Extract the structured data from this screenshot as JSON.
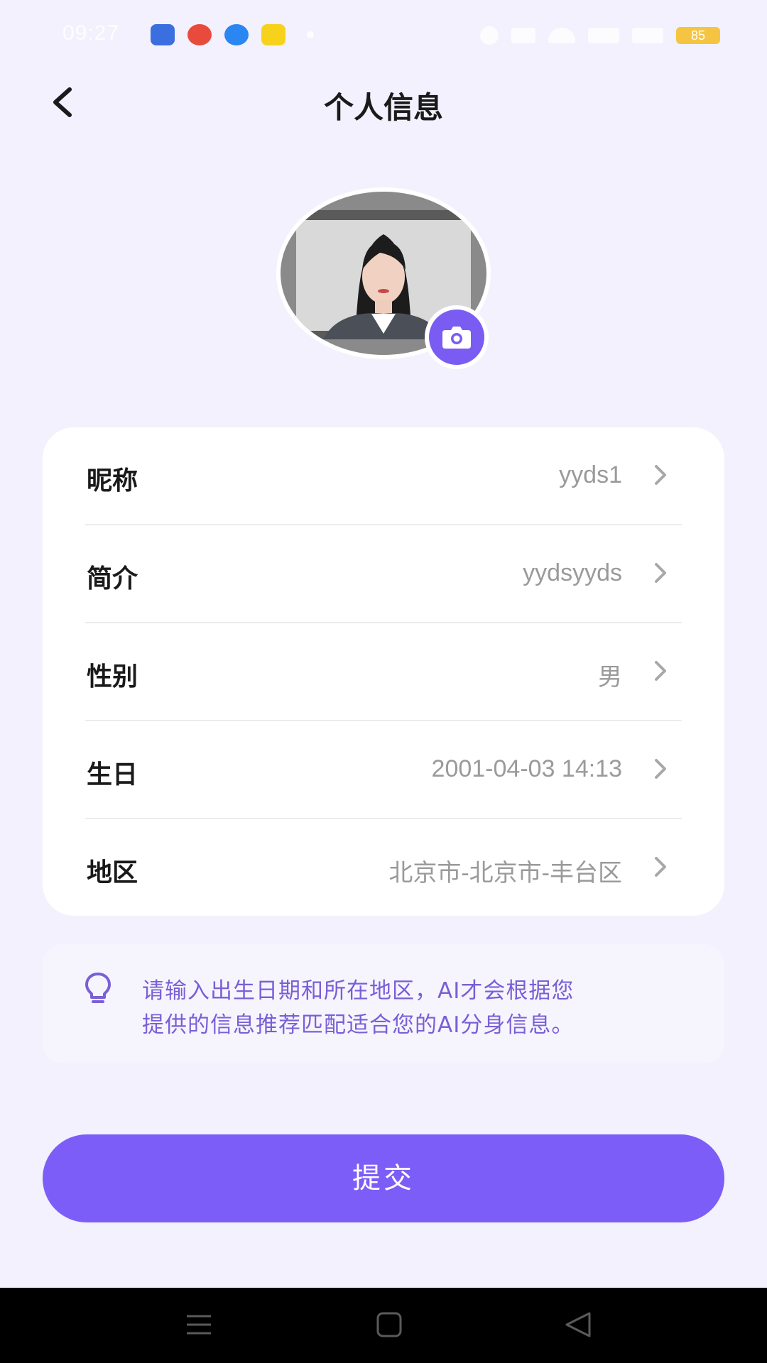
{
  "status_bar": {
    "time": "09:27",
    "battery": "85"
  },
  "header": {
    "title": "个人信息"
  },
  "avatar": {
    "camera_icon": "camera-icon"
  },
  "profile_rows": [
    {
      "label": "昵称",
      "value": "yyds1"
    },
    {
      "label": "简介",
      "value": "yydsyyds"
    },
    {
      "label": "性别",
      "value": "男"
    },
    {
      "label": "生日",
      "value": "2001-04-03 14:13"
    },
    {
      "label": "地区",
      "value": "北京市-北京市-丰台区"
    }
  ],
  "tip": {
    "icon": "lightbulb-icon",
    "line1": "请输入出生日期和所在地区，AI才会根据您",
    "line2": "提供的信息推荐匹配适合您的AI分身信息。"
  },
  "submit": {
    "label": "提交"
  },
  "colors": {
    "accent": "#7d5df7",
    "background": "#f2f1fd",
    "tip_text": "#7a5fd6"
  }
}
